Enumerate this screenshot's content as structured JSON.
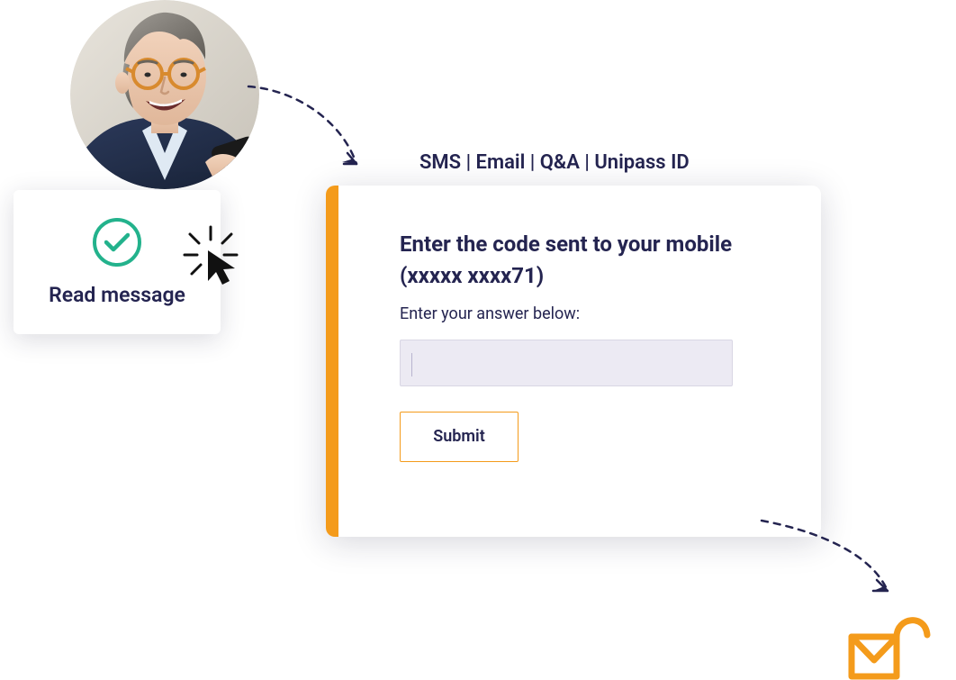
{
  "read_card": {
    "label": "Read message"
  },
  "methods_line": "SMS | Email | Q&A | Unipass ID",
  "verify": {
    "title": "Enter the code sent to your mobile\n(xxxxx xxxx71)",
    "helper": "Enter your answer below:",
    "input_value": "",
    "submit_label": "Submit"
  },
  "colors": {
    "accent_orange": "#f49b1b",
    "brand_navy": "#242450",
    "check_green": "#23b28c"
  }
}
